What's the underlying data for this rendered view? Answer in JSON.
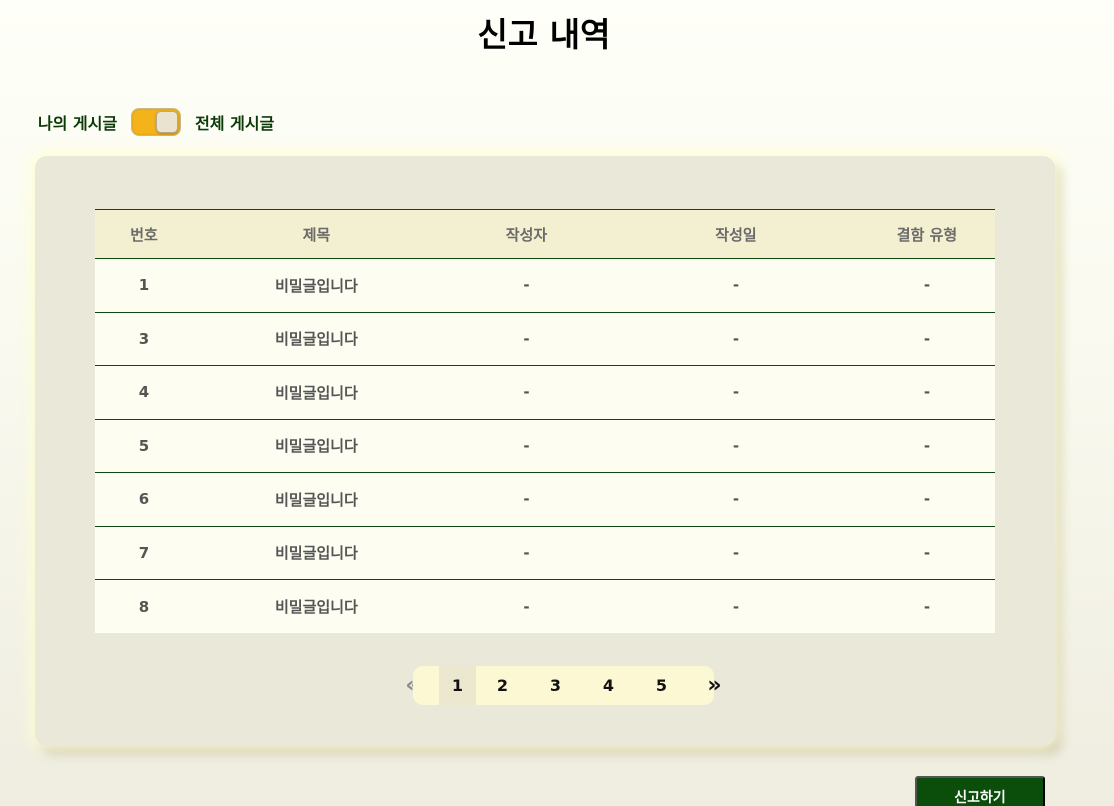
{
  "page": {
    "title": "신고 내역"
  },
  "filter": {
    "left_label": "나의 게시글",
    "right_label": "전체 게시글",
    "toggle_state": "전체 게시글"
  },
  "table": {
    "headers": [
      "번호",
      "제목",
      "작성자",
      "작성일",
      "결함 유형"
    ],
    "rows": [
      [
        "1",
        "비밀글입니다",
        "-",
        "-",
        "-"
      ],
      [
        "3",
        "비밀글입니다",
        "-",
        "-",
        "-"
      ],
      [
        "4",
        "비밀글입니다",
        "-",
        "-",
        "-"
      ],
      [
        "5",
        "비밀글입니다",
        "-",
        "-",
        "-"
      ],
      [
        "6",
        "비밀글입니다",
        "-",
        "-",
        "-"
      ],
      [
        "7",
        "비밀글입니다",
        "-",
        "-",
        "-"
      ],
      [
        "8",
        "비밀글입니다",
        "-",
        "-",
        "-"
      ]
    ]
  },
  "pagination": {
    "prev": "«",
    "next": "»",
    "pages": [
      "1",
      "2",
      "3",
      "4",
      "5"
    ],
    "current": "1"
  },
  "actions": {
    "report_label": "신고하기"
  },
  "colors": {
    "accent_green": "#0b4d0b",
    "toggle_on": "#f4b31a",
    "panel": "#eae8d8",
    "header_row": "#f3f0d1"
  }
}
